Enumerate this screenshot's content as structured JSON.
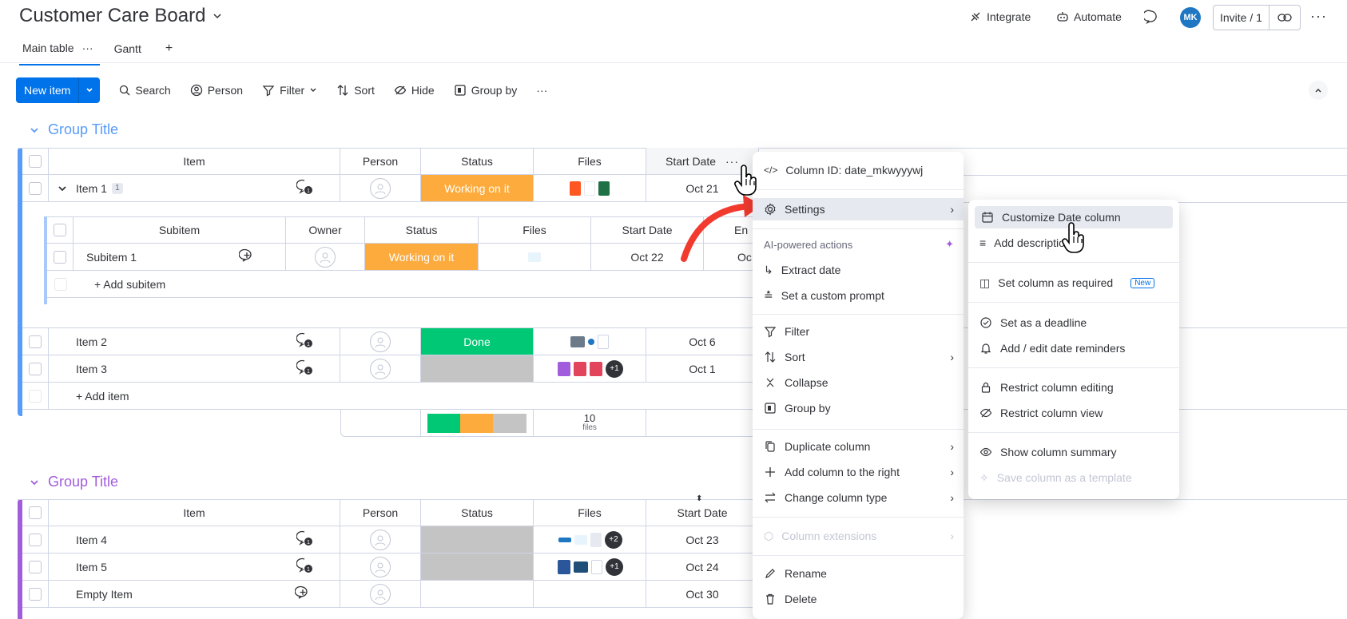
{
  "header": {
    "board_title": "Customer Care Board",
    "integrate_label": "Integrate",
    "automate_label": "Automate",
    "avatar_initials": "MK",
    "invite_label": "Invite / 1"
  },
  "tabs": [
    {
      "label": "Main table",
      "extra": "···"
    },
    {
      "label": "Gantt",
      "extra": ""
    },
    {
      "label": "+",
      "extra": ""
    }
  ],
  "toolbar": {
    "new_item": "New item",
    "search": "Search",
    "person": "Person",
    "filter": "Filter",
    "sort": "Sort",
    "hide": "Hide",
    "group_by": "Group by",
    "more": "···"
  },
  "colors": {
    "accent": "#0073ea",
    "group1": "#579bfc",
    "group2": "#a25ddc",
    "working": "#fdab3d",
    "done": "#00c875",
    "empty_status": "#c4c4c4"
  },
  "group1": {
    "title": "Group Title",
    "columns": [
      "Item",
      "Person",
      "Status",
      "Files",
      "Start Date"
    ],
    "items": [
      {
        "name": "Item 1",
        "badge": "1",
        "status": "Working on it",
        "date": "Oct 21"
      },
      {
        "name": "Item 2",
        "badge": "",
        "status": "Done",
        "date": "Oct 6"
      },
      {
        "name": "Item 3",
        "badge": "",
        "status": "",
        "date": "Oct 1",
        "files_more": "+1"
      }
    ],
    "add_item": "+ Add item",
    "summary_files_count": "10",
    "summary_files_label": "files",
    "status_summary": [
      {
        "color": "#00c875",
        "fraction": 0.33
      },
      {
        "color": "#fdab3d",
        "fraction": 0.33
      },
      {
        "color": "#c4c4c4",
        "fraction": 0.34
      }
    ]
  },
  "subitems": {
    "columns": [
      "Subitem",
      "Owner",
      "Status",
      "Files",
      "Start Date",
      "En"
    ],
    "rows": [
      {
        "name": "Subitem 1",
        "status": "Working on it",
        "date": "Oct 22",
        "end": "Oc"
      }
    ],
    "add_subitem": "+ Add subitem"
  },
  "group2": {
    "title": "Group Title",
    "columns": [
      "Item",
      "Person",
      "Status",
      "Files",
      "Start Date"
    ],
    "items": [
      {
        "name": "Item 4",
        "date": "Oct 23",
        "files_more": "+2"
      },
      {
        "name": "Item 5",
        "date": "Oct 24",
        "files_more": "+1"
      },
      {
        "name": "Empty Item",
        "date": "Oct 30"
      }
    ]
  },
  "column_menu": {
    "column_id": "Column ID: date_mkwyyywj",
    "settings": "Settings",
    "ai_section": "AI-powered actions",
    "extract_date": "Extract date",
    "custom_prompt": "Set a custom prompt",
    "filter": "Filter",
    "sort": "Sort",
    "collapse": "Collapse",
    "group_by": "Group by",
    "duplicate": "Duplicate column",
    "add_right": "Add column to the right",
    "change_type": "Change column type",
    "extensions": "Column extensions",
    "rename": "Rename",
    "delete": "Delete"
  },
  "settings_menu": {
    "customize": "Customize Date column",
    "add_description": "Add description",
    "required": "Set column as required",
    "new_tag": "New",
    "deadline": "Set as a deadline",
    "reminders": "Add / edit date reminders",
    "restrict_edit": "Restrict column editing",
    "restrict_view": "Restrict column view",
    "summary": "Show column summary",
    "save_template": "Save column as a template"
  }
}
